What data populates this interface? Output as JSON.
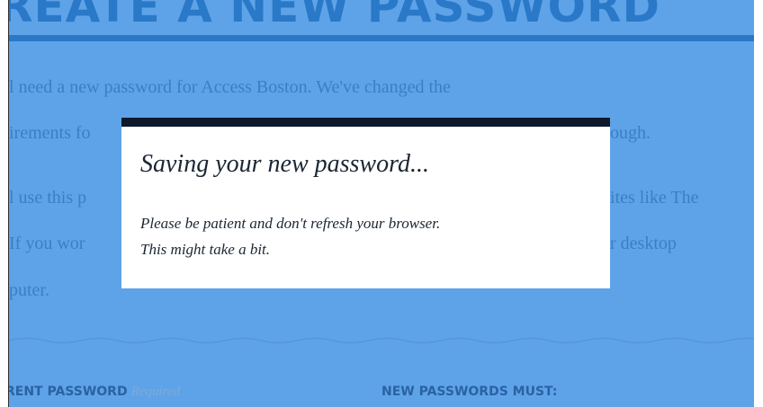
{
  "page": {
    "heading": "REATE A NEW PASSWORD",
    "paragraphs": [
      "l need a new password for Access Boston. We've changed the",
      "irements fo",
      "l use this p",
      " If you wor",
      "puter."
    ],
    "right_fragments": [
      "ough.",
      "ites like The",
      "r desktop"
    ],
    "current_password_label": "RENT PASSWORD",
    "current_password_required": "Required",
    "new_passwords_label": "NEW PASSWORDS MUST:"
  },
  "modal": {
    "title": "Saving your new password...",
    "line1": "Please be patient and don't refresh your browser.",
    "line2": "This might take a bit."
  },
  "colors": {
    "page_bg": "#5ea3e8",
    "accent": "#2b78c5",
    "modal_bar": "#0c1a2b"
  }
}
